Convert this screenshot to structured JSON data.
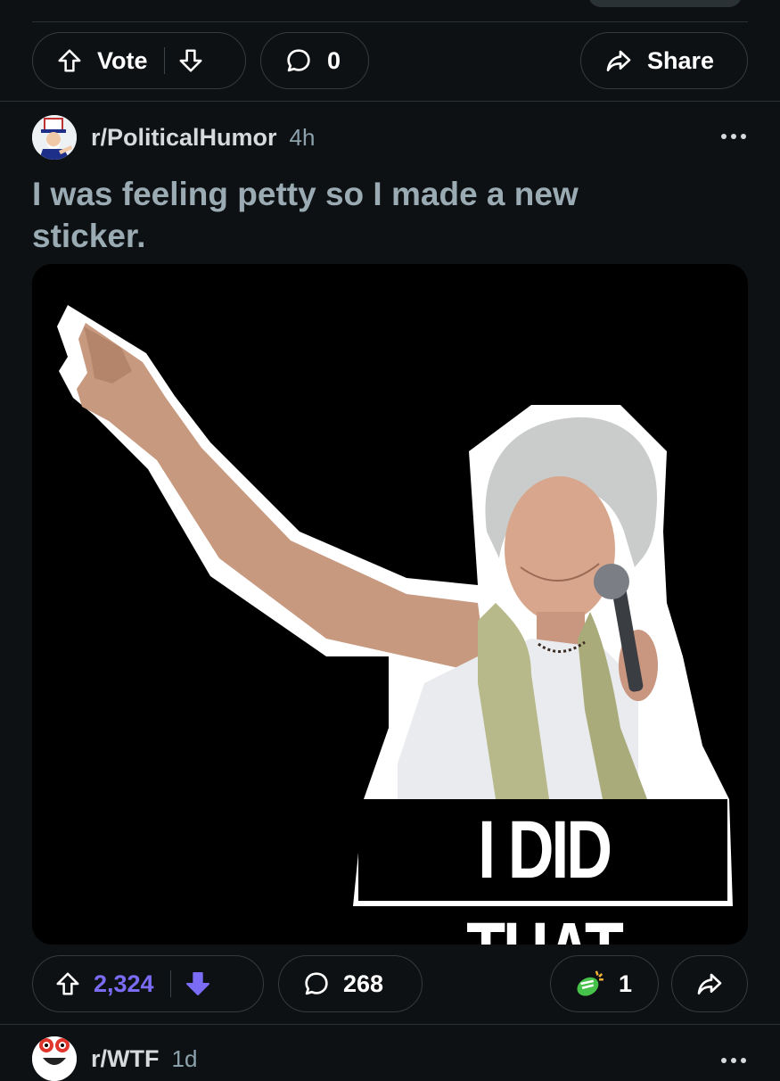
{
  "prev_post": {
    "vote_label": "Vote",
    "comment_count": "0",
    "share_label": "Share"
  },
  "post": {
    "subreddit": "r/PoliticalHumor",
    "time": "4h",
    "title": "I was feeling petty so I made a new sticker.",
    "image_caption": "I DID THAT",
    "vote_count": "2,324",
    "comment_count": "268",
    "award_count": "1",
    "upvote_color": "#7b6cf6"
  },
  "next_post": {
    "subreddit": "r/WTF",
    "time": "1d"
  }
}
